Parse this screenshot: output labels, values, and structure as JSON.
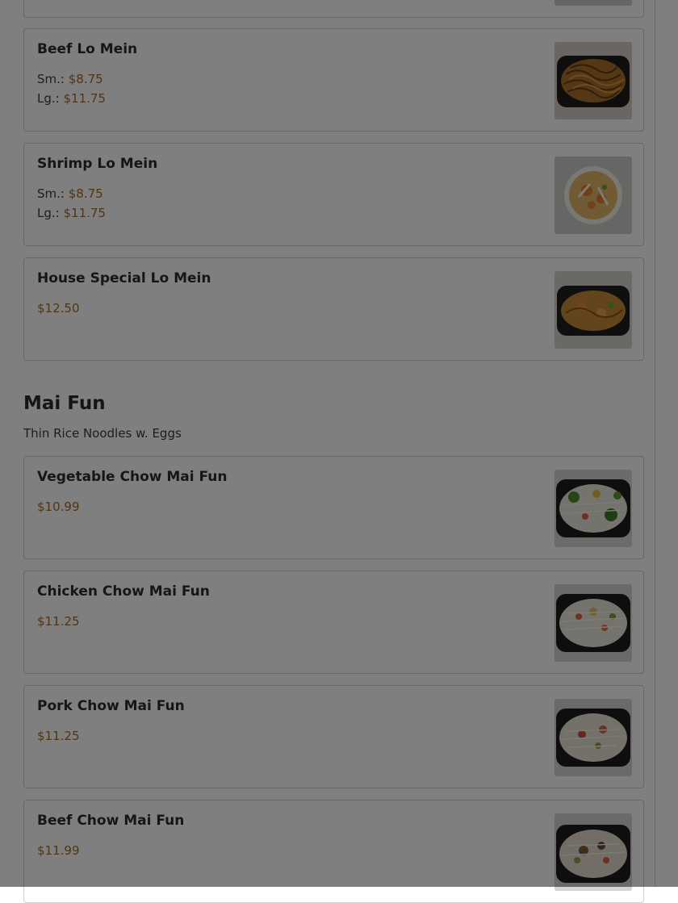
{
  "top_card": {},
  "lo_mein_items": [
    {
      "name": "Beef Lo Mein",
      "small_label": "Sm.:",
      "small_price": "$8.75",
      "large_label": "Lg.:",
      "large_price": "$11.75",
      "image_icon": "noodle-dish-photo"
    },
    {
      "name": "Shrimp Lo Mein",
      "small_label": "Sm.:",
      "small_price": "$8.75",
      "large_label": "Lg.:",
      "large_price": "$11.75",
      "image_icon": "shrimp-dish-photo"
    },
    {
      "name": "House Special Lo Mein",
      "price": "$12.50",
      "image_icon": "noodle-dish-photo"
    }
  ],
  "mai_fun_section": {
    "title": "Mai Fun",
    "description": "Thin Rice Noodles w. Eggs",
    "items": [
      {
        "name": "Vegetable Chow Mai Fun",
        "price": "$10.99",
        "image_icon": "rice-noodle-dish-photo"
      },
      {
        "name": "Chicken Chow Mai Fun",
        "price": "$11.25",
        "image_icon": "rice-noodle-dish-photo"
      },
      {
        "name": "Pork Chow Mai Fun",
        "price": "$11.25",
        "image_icon": "rice-noodle-dish-photo"
      },
      {
        "name": "Beef Chow Mai Fun",
        "price": "$11.99",
        "image_icon": "rice-noodle-dish-photo"
      }
    ]
  },
  "colors": {
    "price": "#a06a2c",
    "text": "#2a2a2a",
    "card_border": "#cfcfcf",
    "overlay": "rgba(0,0,0,0.5)"
  }
}
